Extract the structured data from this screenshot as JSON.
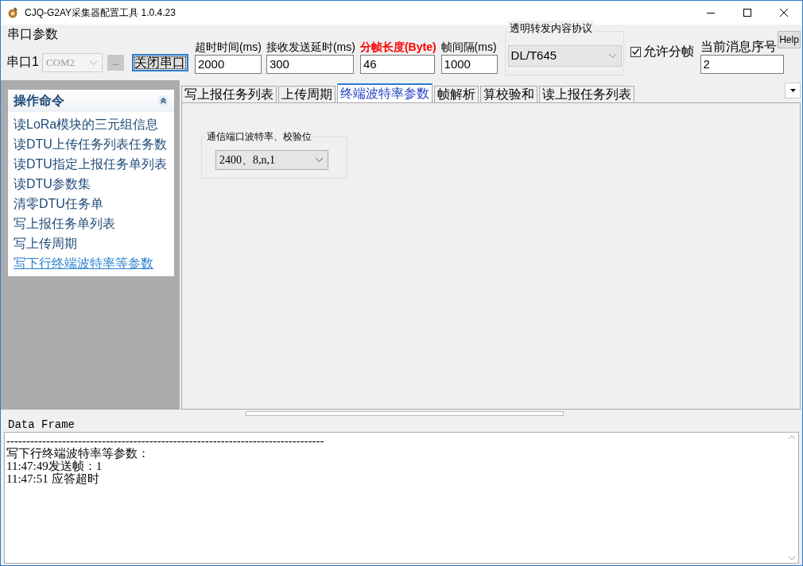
{
  "window": {
    "title": "CJQ-G2AY采集器配置工具 1.0.4.23"
  },
  "serial_group": {
    "title": "串口参数",
    "port_label": "串口1",
    "port_value": "COM2",
    "browse_button": "...",
    "close_button": "关闭串口"
  },
  "fields": [
    {
      "label": "超时时间(ms)",
      "value": "2000",
      "highlight": false
    },
    {
      "label": "接收发送延时(ms)",
      "value": "300",
      "highlight": false
    },
    {
      "label": "分帧长度(Byte)",
      "value": "46",
      "highlight": true
    },
    {
      "label": "帧间隔(ms)",
      "value": "1000",
      "highlight": false
    }
  ],
  "protocol_group": {
    "title": "透明转发内容协议",
    "value": "DL/T645"
  },
  "allow_split": {
    "label": "允许分帧",
    "checked": true
  },
  "sequence": {
    "label": "当前消息序号",
    "value": "2"
  },
  "help_button": "Help",
  "sidebar": {
    "title": "操作命令",
    "items": [
      {
        "label": "读LoRa模块的三元组信息",
        "selected": false
      },
      {
        "label": "读DTU上传任务列表任务数",
        "selected": false
      },
      {
        "label": "读DTU指定上报任务单列表",
        "selected": false
      },
      {
        "label": "读DTU参数集",
        "selected": false
      },
      {
        "label": "清零DTU任务单",
        "selected": false
      },
      {
        "label": "写上报任务单列表",
        "selected": false
      },
      {
        "label": "写上传周期",
        "selected": false
      },
      {
        "label": "写下行终端波特率等参数",
        "selected": true
      }
    ]
  },
  "tabs": [
    {
      "label": "写上报任务列表",
      "selected": false
    },
    {
      "label": "上传周期",
      "selected": false
    },
    {
      "label": "终端波特率参数",
      "selected": true
    },
    {
      "label": "帧解析",
      "selected": false
    },
    {
      "label": "算校验和",
      "selected": false
    },
    {
      "label": "读上报任务列表",
      "selected": false
    }
  ],
  "baud_group": {
    "title": "通信端口波特率、校验位",
    "value": "2400、8,n,1"
  },
  "data_frame": {
    "title": "Data Frame",
    "lines": [
      "--------------------------------------------------------------------------------",
      "写下行终端波特率等参数：",
      "11:47:49发送帧：1",
      "11:47:51 应答超时"
    ]
  }
}
